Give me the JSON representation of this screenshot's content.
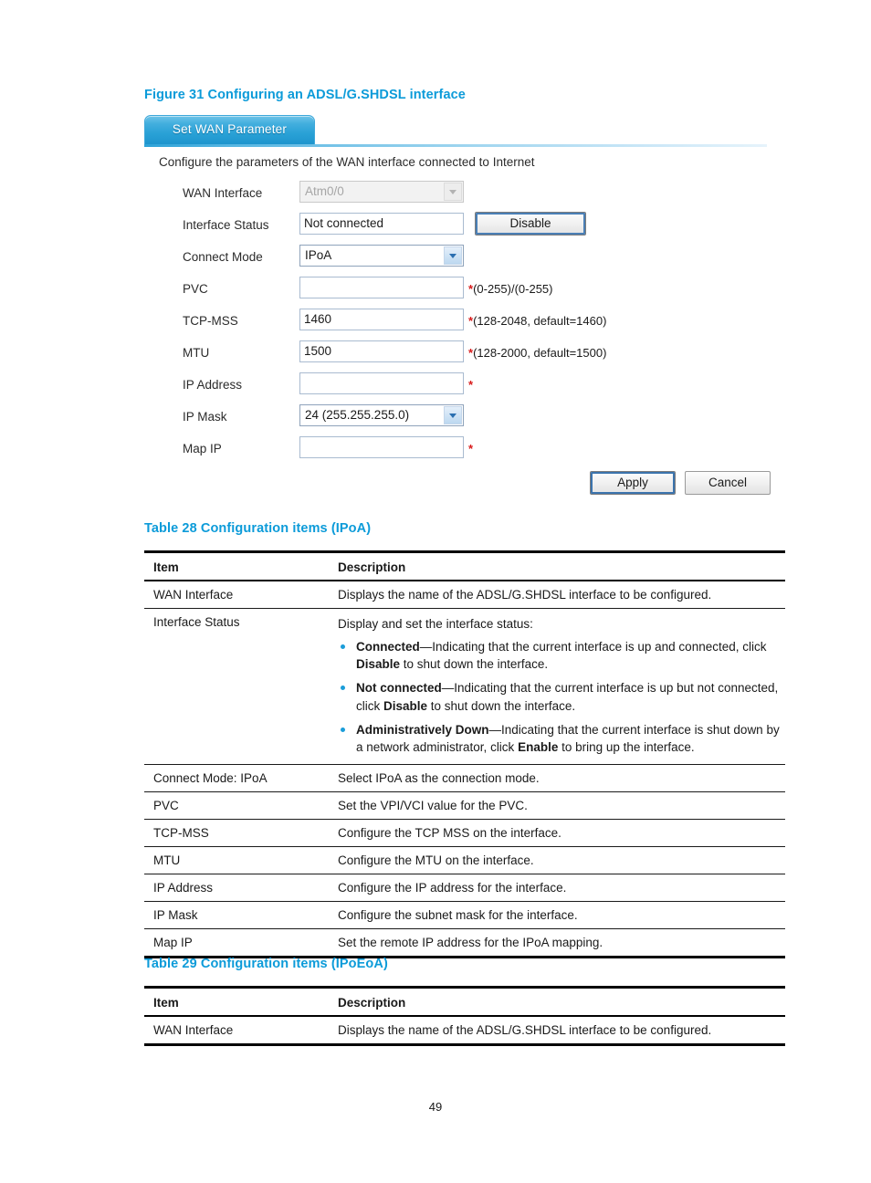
{
  "figure": {
    "caption": "Figure 31 Configuring an ADSL/G.SHDSL interface"
  },
  "ui_panel": {
    "tab_label": "Set WAN Parameter",
    "intro": "Configure the parameters of the WAN interface connected to Internet",
    "fields": {
      "wan_interface": {
        "label": "WAN Interface",
        "value": "Atm0/0",
        "control": "select-disabled"
      },
      "interface_status": {
        "label": "Interface Status",
        "value": "Not connected",
        "button_label": "Disable",
        "control": "text-readonly"
      },
      "connect_mode": {
        "label": "Connect Mode",
        "value": "IPoA",
        "control": "select"
      },
      "pvc": {
        "label": "PVC",
        "value": "",
        "hint": "(0-255)/(0-255)",
        "required": "*",
        "control": "text"
      },
      "tcp_mss": {
        "label": "TCP-MSS",
        "value": "1460",
        "hint": "(128-2048, default=1460)",
        "required": "*",
        "control": "text"
      },
      "mtu": {
        "label": "MTU",
        "value": "1500",
        "hint": "(128-2000, default=1500)",
        "required": "*",
        "control": "text"
      },
      "ip_address": {
        "label": "IP Address",
        "value": "",
        "hint": "",
        "required": "*",
        "control": "text"
      },
      "ip_mask": {
        "label": "IP Mask",
        "value": "24 (255.255.255.0)",
        "control": "select"
      },
      "map_ip": {
        "label": "Map IP",
        "value": "",
        "hint": "",
        "required": "*",
        "control": "text"
      }
    },
    "actions": {
      "apply_label": "Apply",
      "cancel_label": "Cancel"
    },
    "colors": {
      "tab_blue": "#29a1d6",
      "required_red": "#d81a1a"
    }
  },
  "table28": {
    "caption": "Table 28 Configuration items (IPoA)",
    "headers": [
      "Item",
      "Description"
    ],
    "rows": [
      {
        "item": "WAN Interface",
        "description": "Displays the name of the ADSL/G.SHDSL interface to be configured."
      },
      {
        "item": "Interface Status",
        "lead": "Display and set the interface status:",
        "bullets": [
          {
            "term": "Connected",
            "dash": "—",
            "text_a": "Indicating that the current interface is up and connected, click ",
            "term_b": "Disable",
            "text_b": " to shut down the interface."
          },
          {
            "term": "Not connected",
            "dash": "—",
            "text_a": "Indicating that the current interface is up but not connected, click ",
            "term_b": "Disable",
            "text_b": " to shut down the interface."
          },
          {
            "term": "Administratively Down",
            "dash": "—",
            "text_a": "Indicating that the current interface is shut down by a network administrator, click ",
            "term_b": "Enable",
            "text_b": " to bring up the interface."
          }
        ]
      },
      {
        "item": "Connect Mode: IPoA",
        "description": "Select IPoA as the connection mode."
      },
      {
        "item": "PVC",
        "description": "Set the VPI/VCI value for the PVC."
      },
      {
        "item": "TCP-MSS",
        "description": "Configure the TCP MSS on the interface."
      },
      {
        "item": "MTU",
        "description": "Configure the MTU on the interface."
      },
      {
        "item": "IP Address",
        "description": "Configure the IP address for the interface."
      },
      {
        "item": "IP Mask",
        "description": "Configure the subnet mask for the interface."
      },
      {
        "item": "Map IP",
        "description": "Set the remote IP address for the IPoA mapping."
      }
    ]
  },
  "table29": {
    "caption": "Table 29 Configuration items (IPoEoA)",
    "headers": [
      "Item",
      "Description"
    ],
    "rows": [
      {
        "item": "WAN Interface",
        "description": "Displays the name of the ADSL/G.SHDSL interface to be configured."
      }
    ]
  },
  "footer": {
    "page_number": "49"
  }
}
